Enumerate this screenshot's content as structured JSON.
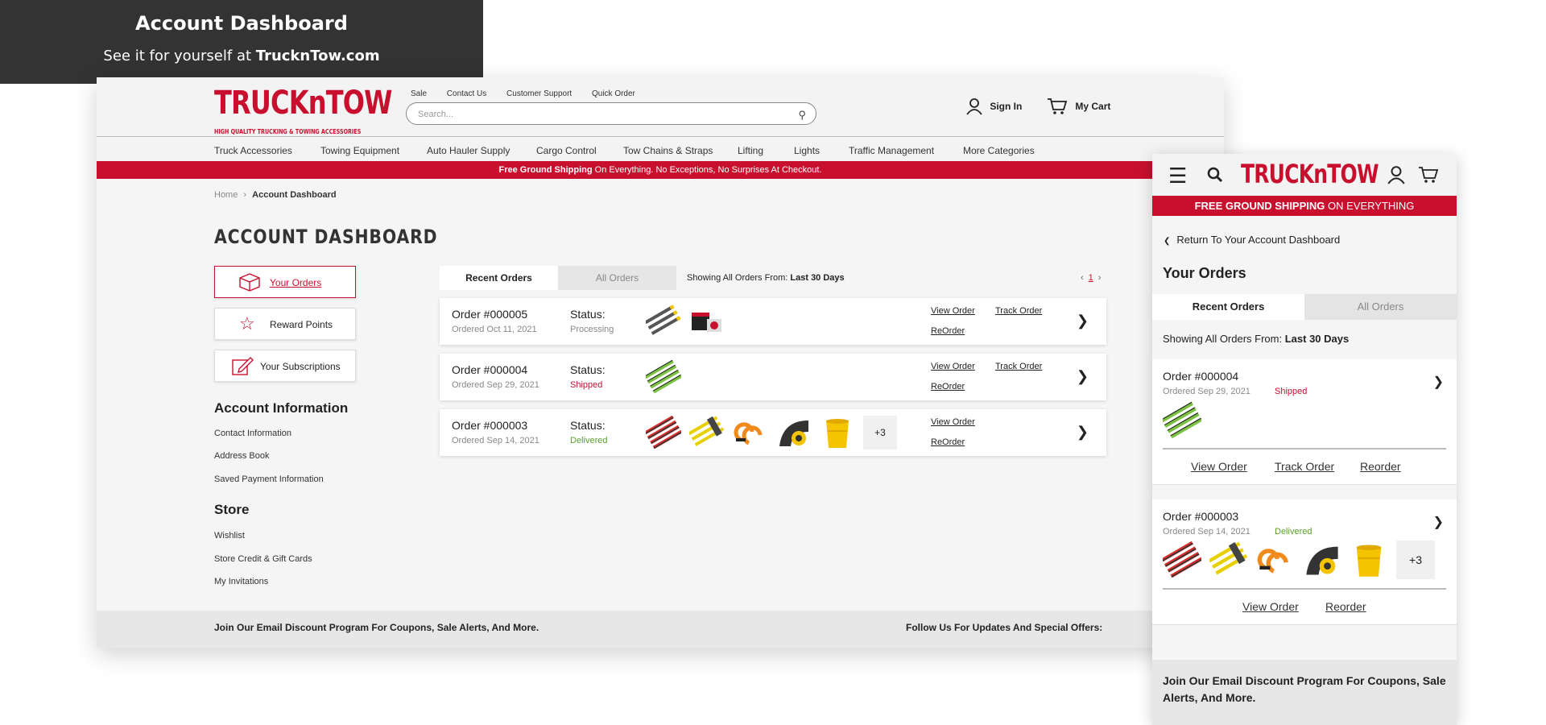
{
  "promo": {
    "title": "Account Dashboard",
    "subtitle_pre": "See it for yourself at",
    "subtitle_site": "TrucknTow.com"
  },
  "brand": {
    "logo_text": "TRUCKnTOW",
    "tagline": "HIGH QUALITY TRUCKING & TOWING ACCESSORIES",
    "accent": "#c8102e"
  },
  "top_links": [
    "Sale",
    "Contact Us",
    "Customer Support",
    "Quick Order"
  ],
  "search": {
    "placeholder": "Search..."
  },
  "header_actions": {
    "sign_in": "Sign In",
    "cart": "My Cart"
  },
  "nav": [
    "Truck Accessories",
    "Towing Equipment",
    "Auto Hauler Supply",
    "Cargo Control",
    "Tow Chains & Straps",
    "Lifting",
    "Lights",
    "Traffic Management",
    "More Categories"
  ],
  "shipping_bar": {
    "bold": "Free Ground Shipping",
    "rest": "On Everything. No Exceptions, No Surprises At Checkout."
  },
  "breadcrumb": {
    "home": "Home",
    "sep": "›",
    "current": "Account Dashboard"
  },
  "page_title": "ACCOUNT DASHBOARD",
  "sidebar": {
    "buttons": [
      "Your Orders",
      "Reward Points",
      "Your Subscriptions"
    ],
    "account_heading": "Account Information",
    "account_links": [
      "Contact Information",
      "Address Book",
      "Saved Payment Information"
    ],
    "store_heading": "Store",
    "store_links": [
      "Wishlist",
      "Store Credit & Gift Cards",
      "My Invitations"
    ]
  },
  "tabs": {
    "recent": "Recent Orders",
    "all": "All Orders"
  },
  "showing": {
    "label": "Showing All Orders From:",
    "value": "Last 30 Days"
  },
  "pager": {
    "prev": "‹",
    "page": "1",
    "next": "›"
  },
  "orders": [
    {
      "number": "Order #000005",
      "date": "Ordered Oct 11, 2021",
      "status_label": "Status:",
      "status": "Processing",
      "status_color": "#888888",
      "view": "View Order",
      "track": "Track Order",
      "reorder": "ReOrder"
    },
    {
      "number": "Order #000004",
      "date": "Ordered Sep 29, 2021",
      "status_label": "Status:",
      "status": "Shipped",
      "status_color": "#c8102e",
      "view": "View Order",
      "track": "Track Order",
      "reorder": "ReOrder"
    },
    {
      "number": "Order #000003",
      "date": "Ordered Sep 14, 2021",
      "status_label": "Status:",
      "status": "Delivered",
      "status_color": "#5aa02c",
      "view": "View Order",
      "reorder": "ReOrder",
      "more": "+3"
    }
  ],
  "footer": {
    "email_text": "Join Our Email Discount Program For Coupons, Sale Alerts, And More.",
    "follow_text": "Follow Us For Updates And Special Offers:"
  },
  "mobile": {
    "shipping": {
      "bold": "FREE GROUND SHIPPING",
      "rest": "ON EVERYTHING"
    },
    "return_link": "Return To Your Account Dashboard",
    "title": "Your Orders",
    "tabs": {
      "recent": "Recent Orders",
      "all": "All Orders"
    },
    "showing": {
      "label": "Showing All Orders From:",
      "value": "Last 30 Days"
    },
    "orders": [
      {
        "number": "Order #000004",
        "date": "Ordered Sep 29, 2021",
        "status": "Shipped",
        "status_color": "#c8102e",
        "links": [
          "View Order",
          "Track Order",
          "Reorder"
        ]
      },
      {
        "number": "Order #000003",
        "date": "Ordered Sep 14, 2021",
        "status": "Delivered",
        "status_color": "#5aa02c",
        "more": "+3",
        "links": [
          "View Order",
          "Reorder"
        ]
      }
    ],
    "footer_text": "Join Our Email Discount Program For Coupons, Sale Alerts, And More."
  }
}
